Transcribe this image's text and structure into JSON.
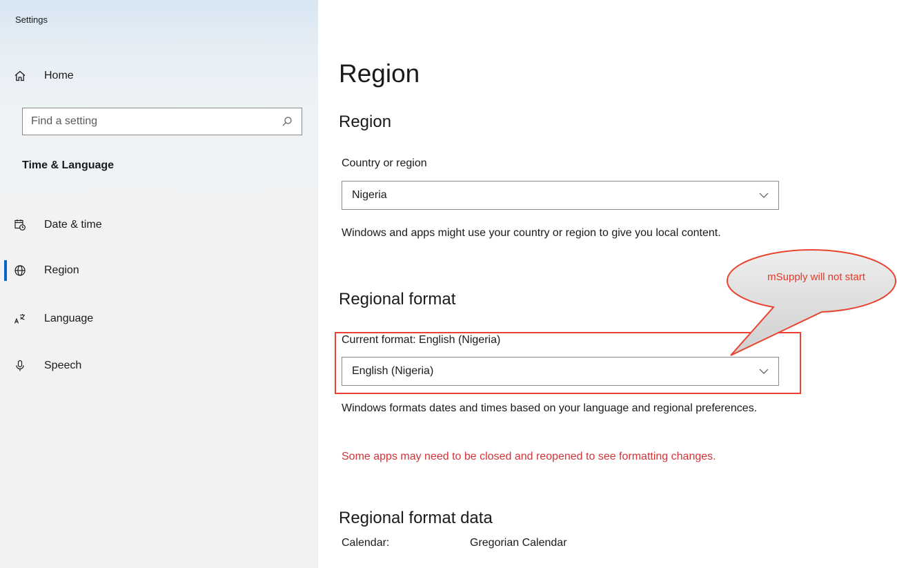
{
  "window": {
    "title": "Settings"
  },
  "sidebar": {
    "home_label": "Home",
    "search_placeholder": "Find a setting",
    "section_heading": "Time & Language",
    "items": [
      {
        "label": "Date & time",
        "icon": "calendar-clock-icon"
      },
      {
        "label": "Region",
        "icon": "globe-icon",
        "active": true
      },
      {
        "label": "Language",
        "icon": "language-icon"
      },
      {
        "label": "Speech",
        "icon": "microphone-icon"
      }
    ],
    "accent_color": "#0067c0"
  },
  "main": {
    "page_title": "Region",
    "region_section": {
      "heading": "Region",
      "country_label": "Country or region",
      "country_value": "Nigeria",
      "description": "Windows and apps might use your country or region to give you local content."
    },
    "format_section": {
      "heading": "Regional format",
      "current_format_label": "Current format: English (Nigeria)",
      "format_value": "English (Nigeria)",
      "description": "Windows formats dates and times based on your language and regional preferences.",
      "warning": "Some apps may need to be closed and reopened to see formatting changes.",
      "warning_color": "#d13438"
    },
    "format_data_section": {
      "heading": "Regional format data",
      "rows": [
        {
          "label": "Calendar:",
          "value": "Gregorian Calendar"
        }
      ]
    }
  },
  "annotation": {
    "callout_text": "mSupply will not start",
    "color": "#e8432e"
  }
}
